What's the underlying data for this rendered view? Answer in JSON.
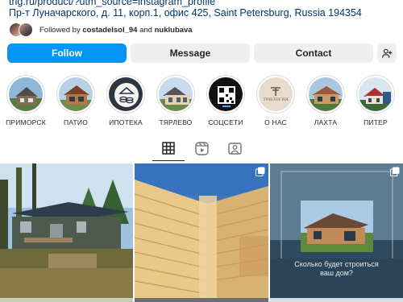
{
  "profile": {
    "link": "trig.ru/product/?utm_source=instagram_profile",
    "address": "Пр-т Луначарского, д. 11, корп.1, офис 425, Saint Petersburg, Russia 194354",
    "followed_prefix": "Followed by ",
    "followed_user1": "costadelsol_94",
    "followed_and": " and ",
    "followed_user2": "nuklubava"
  },
  "actions": {
    "follow": "Follow",
    "message": "Message",
    "contact": "Contact"
  },
  "highlights": [
    {
      "label": "ПРИМОРСК"
    },
    {
      "label": "ПАТИО"
    },
    {
      "label": "ИПОТЕКА"
    },
    {
      "label": "ТЯРЛЕВО"
    },
    {
      "label": "СОЦСЕТИ"
    },
    {
      "label": "О НАС"
    },
    {
      "label": "ЛАХТА"
    },
    {
      "label": "ПИТЕР"
    }
  ],
  "highlight_logo_text": "ТРИЛОГИЯ",
  "tabs": [
    {
      "icon": "grid-icon",
      "active": true
    },
    {
      "icon": "reels-icon",
      "active": false
    },
    {
      "icon": "tagged-icon",
      "active": false
    }
  ],
  "posts": [
    {
      "caption": ""
    },
    {
      "caption": ""
    },
    {
      "caption": "Сколько будет строиться ваш дом?"
    }
  ],
  "colors": {
    "accent": "#0095f6",
    "link": "#00376b",
    "button_bg": "#efefef",
    "text": "#262626"
  }
}
